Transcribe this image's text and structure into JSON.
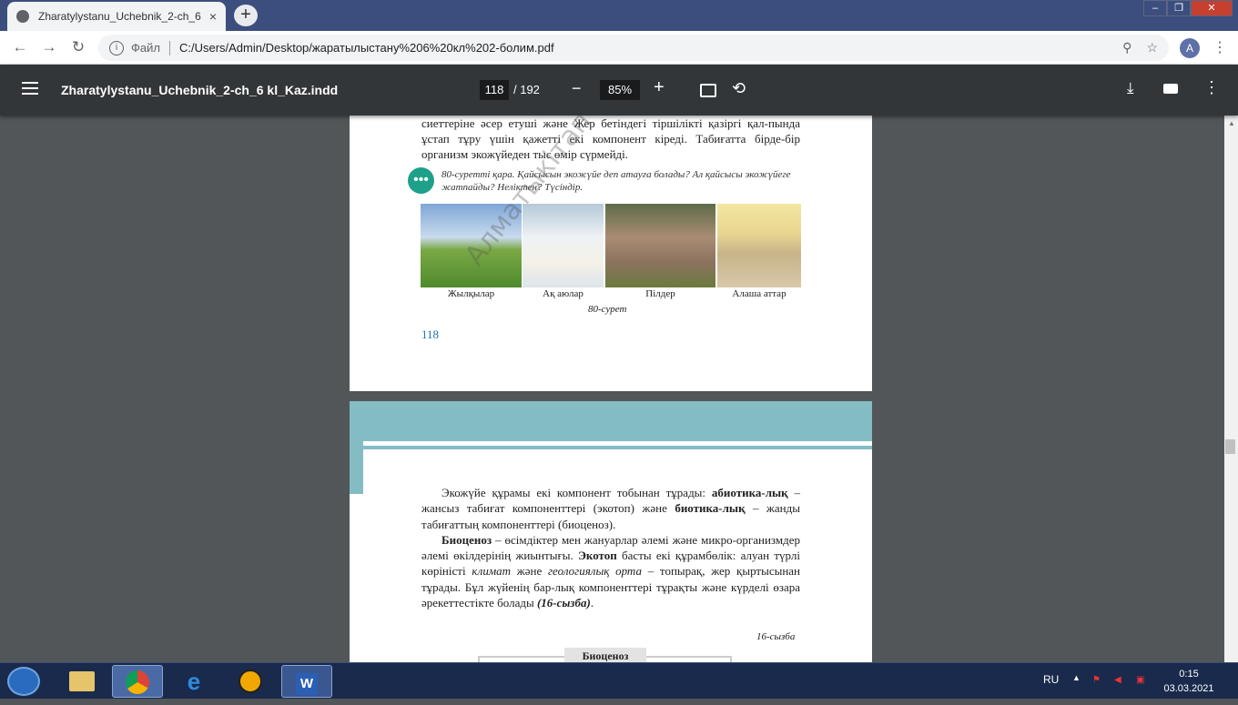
{
  "browser": {
    "tab_title": "Zharatylystanu_Uchebnik_2-ch_6",
    "tab_close": "×",
    "new_tab": "+",
    "window_controls": [
      "‒",
      "❐",
      "✕"
    ],
    "back": "←",
    "forward": "→",
    "reload": "↻",
    "info": "i",
    "scheme_label": "Файл",
    "url": "C:/Users/Admin/Desktop/жаратылыстану%206%20кл%202-болим.pdf",
    "zoom_icon": "⚲",
    "star_icon": "☆",
    "avatar_letter": "A",
    "menu": "⋮"
  },
  "pdf_toolbar": {
    "doc_title": "Zharatylystanu_Uchebnik_2-ch_6 kl_Kaz.indd",
    "current_page": "118",
    "total_pages": "/ 192",
    "zoom_out": "−",
    "zoom": "85%",
    "zoom_in": "+",
    "rotate": "⟲",
    "download": "⤓",
    "more": "⋮"
  },
  "page1": {
    "text_lines": "сиеттеріне әсер етуші және Жер бетіндегі тіршілікті қазіргі қал-пында ұстап тұру үшін қажетті екі компонент кіреді. Табиғатта бірде-бір организм экожүйеден тыс өмір сүрмейді.",
    "question_icon": "•••",
    "question": "80-суретті қара. Қайсысын экожүйе деп атауға болады? Ал қайсысы экожүйеге жатпайды? Неліктен? Түсіндір.",
    "captions": [
      "Жылқылар",
      "Ақ аюлар",
      "Пілдер",
      "Алаша аттар"
    ],
    "figure_caption": "80-сурет",
    "page_number": "118",
    "watermark": "Алматыкітап баспасы"
  },
  "page2": {
    "paragraph1_a": "Экожүйе құрамы екі компонент тобынан тұрады: ",
    "paragraph1_b": "абиотика-лық",
    "paragraph1_c": " – жансыз табиғат компоненттері (экотоп) және ",
    "paragraph1_d": "биотика-лық",
    "paragraph1_e": " – жанды табиғаттың компоненттері (биоценоз).",
    "paragraph2_a": "Биоценоз",
    "paragraph2_b": " – өсімдіктер мен жануарлар әлемі және микро-организмдер әлемі өкілдерінің жиынтығы. ",
    "paragraph2_c": "Экотоп",
    "paragraph2_d": " басты екі құрамбөлік: алуан түрлі көріністі ",
    "paragraph2_e": "климат",
    "paragraph2_f": " және ",
    "paragraph2_g": "геологиялық орта",
    "paragraph2_h": " – топырақ, жер қыртысынан тұрады. Бұл жүйенің бар-лық компоненттері тұрақты және күрделі өзара әрекеттестікте болады ",
    "paragraph2_i": "(16-сызба)",
    "paragraph2_j": ".",
    "scheme_label": "16-сызба",
    "scheme_title": "Биоценоз"
  },
  "taskbar": {
    "language": "RU",
    "tray_up": "▲",
    "time": "0:15",
    "date": "03.03.2021"
  },
  "colors": {
    "tab_strip": "#3c4e7e",
    "pdf_toolbar": "#323639",
    "page_accent": "#84bcc3",
    "page_number": "#1d71b8",
    "question_icon": "#1ea08a"
  }
}
